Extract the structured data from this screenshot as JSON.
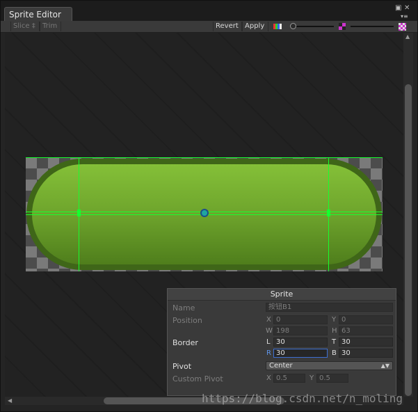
{
  "window": {
    "tab_title": "Sprite Editor",
    "maximize_icon": "restore-icon",
    "close_icon": "close-icon",
    "menu_icon": "context-menu-icon"
  },
  "toolbar": {
    "slice_label": "Slice ‡",
    "trim_label": "Trim",
    "revert_label": "Revert",
    "apply_label": "Apply",
    "zoom_level": 0.1,
    "mip_level": 0.5
  },
  "sprite_panel": {
    "title": "Sprite",
    "name_label": "Name",
    "name_value": "按钮B1",
    "position_label": "Position",
    "x_label": "X",
    "x_value": "0",
    "y_label": "Y",
    "y_value": "0",
    "w_label": "W",
    "w_value": "198",
    "h_label": "H",
    "h_value": "63",
    "border_label": "Border",
    "l_label": "L",
    "l_value": "30",
    "t_label": "T",
    "t_value": "30",
    "r_label": "R",
    "r_value": "30",
    "b_label": "B",
    "b_value": "30",
    "pivot_label": "Pivot",
    "pivot_value": "Center",
    "custom_pivot_label": "Custom Pivot",
    "cp_x_label": "X",
    "cp_x_value": "0.5",
    "cp_y_label": "Y",
    "cp_y_value": "0.5"
  },
  "watermark": "https://blog.csdn.net/n_moling",
  "colors": {
    "border_guide": "#16ff2e",
    "sprite_green": "#78b232",
    "focus": "#3d6fd1"
  }
}
